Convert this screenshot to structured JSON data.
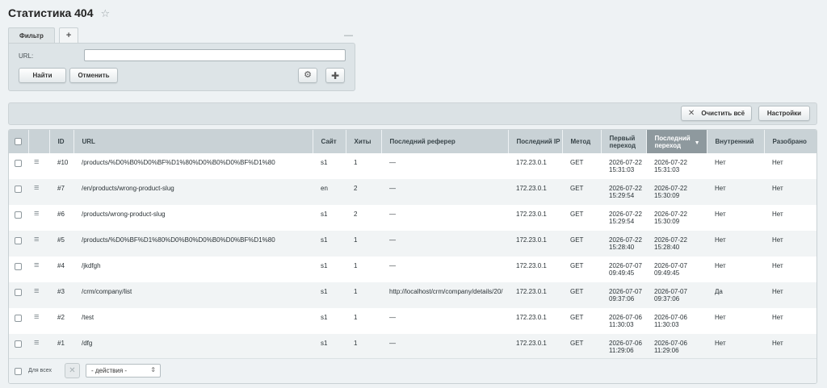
{
  "page": {
    "title": "Статистика 404"
  },
  "filter": {
    "tab_label": "Фильтр",
    "add_tab_label": "+",
    "url_label": "URL:",
    "url_value": "",
    "find_button": "Найти",
    "cancel_button": "Отменить"
  },
  "toolbar": {
    "clear_all_button": "Очистить всё",
    "settings_button": "Настройки"
  },
  "grid": {
    "columns": {
      "id": "ID",
      "url": "URL",
      "site": "Сайт",
      "hits": "Хиты",
      "referer": "Последний реферер",
      "ip": "Последний IP",
      "method": "Метод",
      "first": "Первый переход",
      "last": "Последний переход",
      "internal": "Внутренний",
      "resolved": "Разобрано"
    },
    "sorted_column": "last",
    "sort_direction": "desc",
    "rows": [
      {
        "id": "#10",
        "url": "/products/%D0%B0%D0%BF%D1%80%D0%B0%D0%BF%D1%80",
        "site": "s1",
        "hits": "1",
        "referer": "—",
        "ip": "172.23.0.1",
        "method": "GET",
        "first_date": "2026-07-22",
        "first_time": "15:31:03",
        "last_date": "2026-07-22",
        "last_time": "15:31:03",
        "internal": "Нет",
        "resolved": "Нет"
      },
      {
        "id": "#7",
        "url": "/en/products/wrong-product-slug",
        "site": "en",
        "hits": "2",
        "referer": "—",
        "ip": "172.23.0.1",
        "method": "GET",
        "first_date": "2026-07-22",
        "first_time": "15:29:54",
        "last_date": "2026-07-22",
        "last_time": "15:30:09",
        "internal": "Нет",
        "resolved": "Нет"
      },
      {
        "id": "#6",
        "url": "/products/wrong-product-slug",
        "site": "s1",
        "hits": "2",
        "referer": "—",
        "ip": "172.23.0.1",
        "method": "GET",
        "first_date": "2026-07-22",
        "first_time": "15:29:54",
        "last_date": "2026-07-22",
        "last_time": "15:30:09",
        "internal": "Нет",
        "resolved": "Нет"
      },
      {
        "id": "#5",
        "url": "/products/%D0%BF%D1%80%D0%B0%D0%B0%D0%BF%D1%80",
        "site": "s1",
        "hits": "1",
        "referer": "—",
        "ip": "172.23.0.1",
        "method": "GET",
        "first_date": "2026-07-22",
        "first_time": "15:28:40",
        "last_date": "2026-07-22",
        "last_time": "15:28:40",
        "internal": "Нет",
        "resolved": "Нет"
      },
      {
        "id": "#4",
        "url": "/jkdfgh",
        "site": "s1",
        "hits": "1",
        "referer": "—",
        "ip": "172.23.0.1",
        "method": "GET",
        "first_date": "2026-07-07",
        "first_time": "09:49:45",
        "last_date": "2026-07-07",
        "last_time": "09:49:45",
        "internal": "Нет",
        "resolved": "Нет"
      },
      {
        "id": "#3",
        "url": "/crm/company/list",
        "site": "s1",
        "hits": "1",
        "referer": "http://localhost/crm/company/details/20/",
        "ip": "172.23.0.1",
        "method": "GET",
        "first_date": "2026-07-07",
        "first_time": "09:37:06",
        "last_date": "2026-07-07",
        "last_time": "09:37:06",
        "internal": "Да",
        "resolved": "Нет"
      },
      {
        "id": "#2",
        "url": "/test",
        "site": "s1",
        "hits": "1",
        "referer": "—",
        "ip": "172.23.0.1",
        "method": "GET",
        "first_date": "2026-07-06",
        "first_time": "11:30:03",
        "last_date": "2026-07-06",
        "last_time": "11:30:03",
        "internal": "Нет",
        "resolved": "Нет"
      },
      {
        "id": "#1",
        "url": "/dfg",
        "site": "s1",
        "hits": "1",
        "referer": "—",
        "ip": "172.23.0.1",
        "method": "GET",
        "first_date": "2026-07-06",
        "first_time": "11:29:06",
        "last_date": "2026-07-06",
        "last_time": "11:29:06",
        "internal": "Нет",
        "resolved": "Нет"
      }
    ]
  },
  "footer": {
    "select_all_label": "Для всех",
    "actions_placeholder": "- действия -"
  },
  "icons": {
    "favorite": "star-icon",
    "gear": "gear-icon",
    "add": "plus-icon",
    "clear": "close-icon",
    "row_menu": "menu-icon"
  }
}
